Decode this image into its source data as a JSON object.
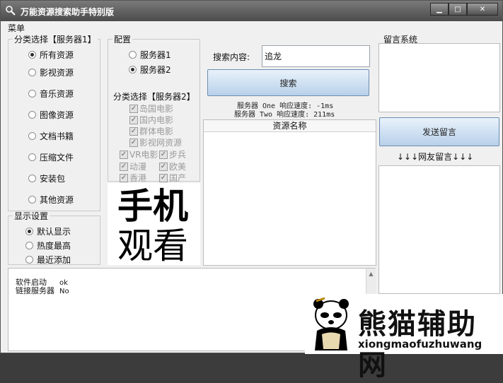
{
  "window": {
    "title": "万能资源搜索助手特别版",
    "minimize": "▁",
    "maximize": "□",
    "close": "✕"
  },
  "menu": {
    "label": "菜单"
  },
  "category1": {
    "legend": "分类选择【服务器1】",
    "items": [
      "所有资源",
      "影视资源",
      "音乐资源",
      "图像资源",
      "文档书籍",
      "压缩文件",
      "安装包",
      "其他资源"
    ],
    "selected_index": 0
  },
  "display": {
    "legend": "显示设置",
    "items": [
      "默认显示",
      "热度最高",
      "最近添加"
    ],
    "selected_index": 0
  },
  "config": {
    "legend": "配置",
    "servers": [
      "服务器1",
      "服务器2"
    ],
    "selected_index": 1
  },
  "category2": {
    "legend": "分类选择【服务器2】",
    "items": [
      "岛国电影",
      "国内电影",
      "群体电影",
      "影视网资源"
    ],
    "small_items": [
      "VR电影",
      "步兵",
      "动漫",
      "欧美",
      "香港",
      "国产"
    ]
  },
  "promo": {
    "line1": "手机",
    "line2": "观看"
  },
  "search": {
    "label": "搜索内容:",
    "value": "追龙",
    "button": "搜索"
  },
  "speed": {
    "one": "服务器 One 响应速度: -1ms",
    "two": "服务器 Two 响应速度: 211ms"
  },
  "results": {
    "header": "资源名称"
  },
  "messages": {
    "legend": "留言系统",
    "send_button": "发送留言",
    "divider": "↓↓↓网友留言↓↓↓"
  },
  "log": {
    "rows": [
      {
        "key": "软件启动",
        "value": "ok"
      },
      {
        "key": "链接服务器",
        "value": "No"
      }
    ]
  },
  "brand": {
    "name": "熊猫辅助网",
    "url": "xiongmaofuzhuwang",
    "color": "#111111"
  }
}
